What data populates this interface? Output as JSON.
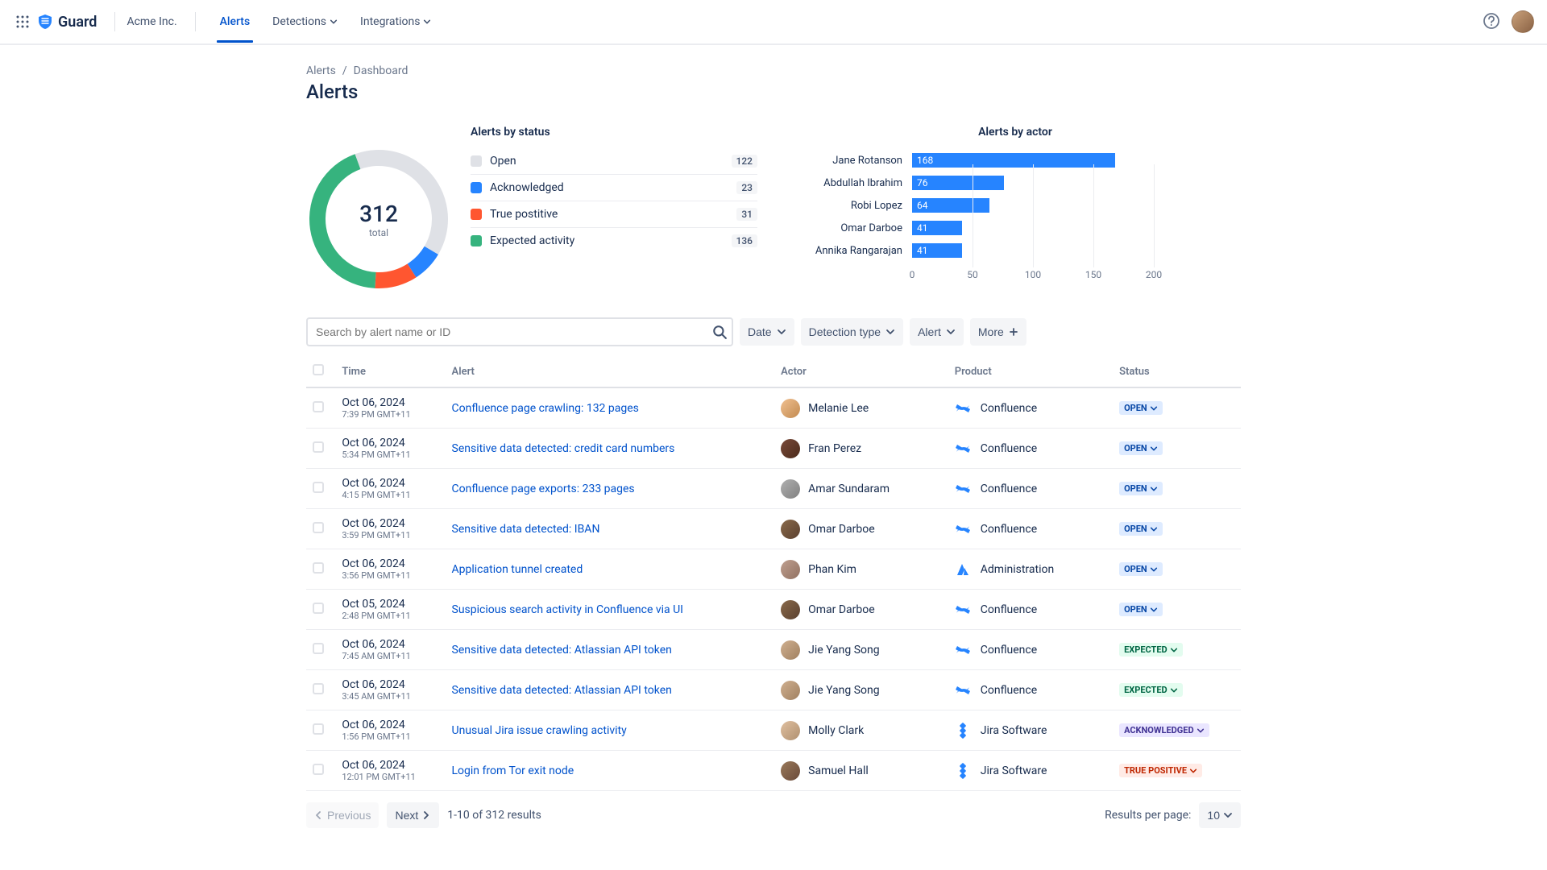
{
  "brand": {
    "name": "Guard"
  },
  "org": "Acme Inc.",
  "nav": [
    {
      "label": "Alerts",
      "active": true,
      "dropdown": false
    },
    {
      "label": "Detections",
      "active": false,
      "dropdown": true
    },
    {
      "label": "Integrations",
      "active": false,
      "dropdown": true
    }
  ],
  "breadcrumb": {
    "root": "Alerts",
    "sep": "/",
    "current": "Dashboard"
  },
  "page_title": "Alerts",
  "status_panel": {
    "title": "Alerts by status",
    "total": "312",
    "total_label": "total",
    "items": [
      {
        "label": "Open",
        "count": "122",
        "color": "#DFE1E6"
      },
      {
        "label": "Acknowledged",
        "count": "23",
        "color": "#2684FF"
      },
      {
        "label": "True postitive",
        "count": "31",
        "color": "#FF5630"
      },
      {
        "label": "Expected activity",
        "count": "136",
        "color": "#36B37E"
      }
    ]
  },
  "actors_panel": {
    "title": "Alerts by actor",
    "max": 200,
    "ticks": [
      "0",
      "50",
      "100",
      "150",
      "200"
    ],
    "items": [
      {
        "name": "Jane Rotanson",
        "value": "168"
      },
      {
        "name": "Abdullah Ibrahim",
        "value": "76"
      },
      {
        "name": "Robi Lopez",
        "value": "64"
      },
      {
        "name": "Omar Darboe",
        "value": "41"
      },
      {
        "name": "Annika Rangarajan",
        "value": "41"
      }
    ]
  },
  "chart_data": [
    {
      "type": "pie",
      "title": "Alerts by status",
      "categories": [
        "Open",
        "Acknowledged",
        "True postitive",
        "Expected activity"
      ],
      "values": [
        122,
        23,
        31,
        136
      ],
      "total": 312
    },
    {
      "type": "bar",
      "orientation": "horizontal",
      "title": "Alerts by actor",
      "categories": [
        "Jane Rotanson",
        "Abdullah Ibrahim",
        "Robi Lopez",
        "Omar Darboe",
        "Annika Rangarajan"
      ],
      "values": [
        168,
        76,
        64,
        41,
        41
      ],
      "xlim": [
        0,
        200
      ],
      "xlabel": "",
      "ylabel": ""
    }
  ],
  "search": {
    "placeholder": "Search by alert name or ID"
  },
  "filters": [
    {
      "label": "Date",
      "icon": "chevron"
    },
    {
      "label": "Detection type",
      "icon": "chevron"
    },
    {
      "label": "Alert",
      "icon": "chevron"
    },
    {
      "label": "More",
      "icon": "plus"
    }
  ],
  "columns": {
    "time": "Time",
    "alert": "Alert",
    "actor": "Actor",
    "product": "Product",
    "status": "Status"
  },
  "rows": [
    {
      "date": "Oct 06, 2024",
      "time": "7:39 PM GMT+11",
      "alert": "Confluence page crawling: 132 pages",
      "actor": "Melanie Lee",
      "product": "Confluence",
      "product_icon": "confluence",
      "status": "OPEN",
      "status_class": "lz-open",
      "avatar": "linear-gradient(135deg,#f0c090,#c28a50)"
    },
    {
      "date": "Oct 06, 2024",
      "time": "5:34 PM GMT+11",
      "alert": "Sensitive data detected: credit card numbers",
      "actor": "Fran Perez",
      "product": "Confluence",
      "product_icon": "confluence",
      "status": "OPEN",
      "status_class": "lz-open",
      "avatar": "linear-gradient(135deg,#7a4a3a,#4a2a1a)"
    },
    {
      "date": "Oct 06, 2024",
      "time": "4:15 PM GMT+11",
      "alert": "Confluence page exports: 233 pages",
      "actor": "Amar Sundaram",
      "product": "Confluence",
      "product_icon": "confluence",
      "status": "OPEN",
      "status_class": "lz-open",
      "avatar": "linear-gradient(135deg,#b0b0b0,#808080)"
    },
    {
      "date": "Oct 06, 2024",
      "time": "3:59 PM GMT+11",
      "alert": "Sensitive data detected: IBAN",
      "actor": "Omar Darboe",
      "product": "Confluence",
      "product_icon": "confluence",
      "status": "OPEN",
      "status_class": "lz-open",
      "avatar": "linear-gradient(135deg,#8a6a4a,#5a4030)"
    },
    {
      "date": "Oct 06, 2024",
      "time": "3:56 PM GMT+11",
      "alert": "Application tunnel created",
      "actor": "Phan Kim",
      "product": "Administration",
      "product_icon": "atlassian",
      "status": "OPEN",
      "status_class": "lz-open",
      "avatar": "linear-gradient(135deg,#c0a090,#907060)"
    },
    {
      "date": "Oct 05, 2024",
      "time": "2:48 PM GMT+11",
      "alert": "Suspicious search activity in Confluence via UI",
      "actor": "Omar Darboe",
      "product": "Confluence",
      "product_icon": "confluence",
      "status": "OPEN",
      "status_class": "lz-open",
      "avatar": "linear-gradient(135deg,#8a6a4a,#5a4030)"
    },
    {
      "date": "Oct 06, 2024",
      "time": "7:45 AM GMT+11",
      "alert": "Sensitive data detected: Atlassian API token",
      "actor": "Jie Yang Song",
      "product": "Confluence",
      "product_icon": "confluence",
      "status": "EXPECTED",
      "status_class": "lz-expected",
      "avatar": "linear-gradient(135deg,#d0b090,#a08060)"
    },
    {
      "date": "Oct 06, 2024",
      "time": "3:45 AM GMT+11",
      "alert": "Sensitive data detected: Atlassian API token",
      "actor": "Jie Yang Song",
      "product": "Confluence",
      "product_icon": "confluence",
      "status": "EXPECTED",
      "status_class": "lz-expected",
      "avatar": "linear-gradient(135deg,#d0b090,#a08060)"
    },
    {
      "date": "Oct 06, 2024",
      "time": "1:56 PM GMT+11",
      "alert": "Unusual Jira issue crawling activity",
      "actor": "Molly Clark",
      "product": "Jira Software",
      "product_icon": "jira",
      "status": "ACKNOWLEDGED",
      "status_class": "lz-ack",
      "avatar": "linear-gradient(135deg,#e0c0a0,#b09070)"
    },
    {
      "date": "Oct 06, 2024",
      "time": "12:01 PM GMT+11",
      "alert": "Login from Tor exit node",
      "actor": "Samuel Hall",
      "product": "Jira Software",
      "product_icon": "jira",
      "status": "TRUE POSITIVE",
      "status_class": "lz-true",
      "avatar": "linear-gradient(135deg,#9a7a5a,#6a4a3a)"
    }
  ],
  "pagination": {
    "prev": "Previous",
    "next": "Next",
    "info": "1-10 of 312 results",
    "per_page_label": "Results per page:",
    "per_page_value": "10"
  }
}
